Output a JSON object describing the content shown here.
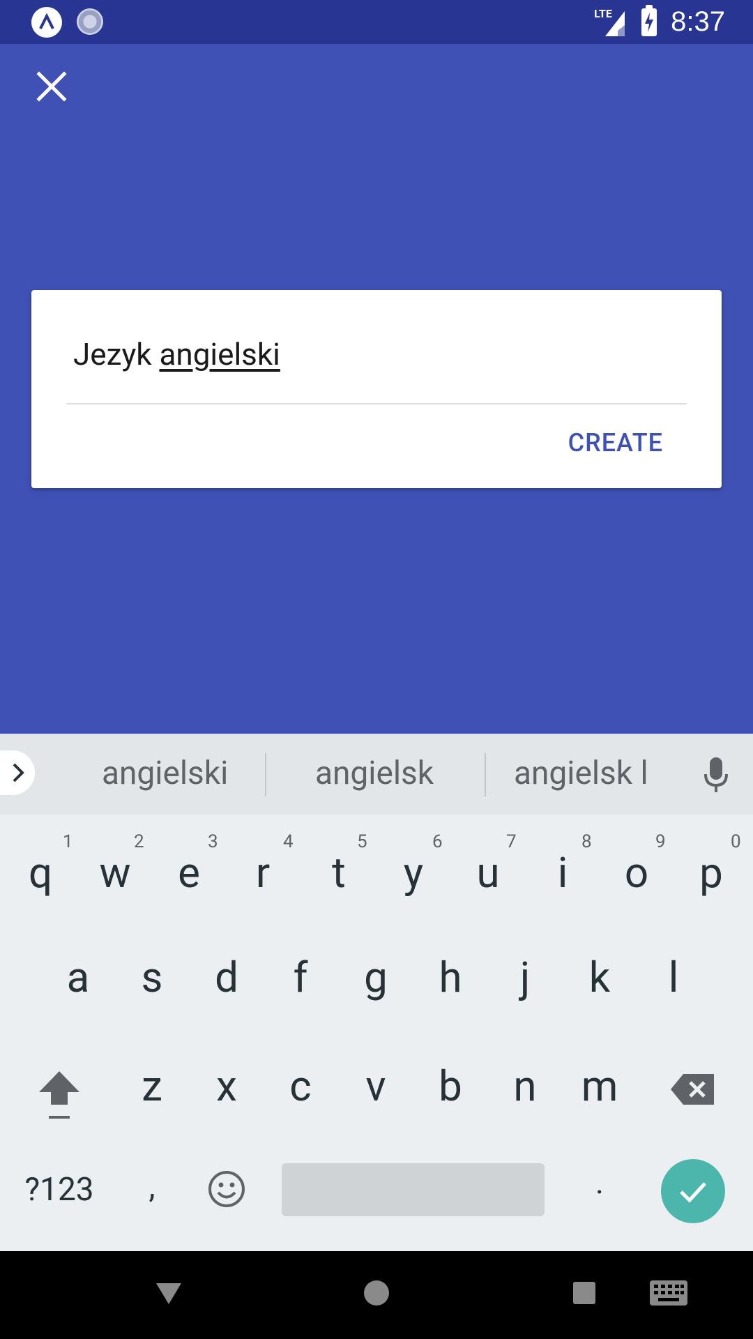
{
  "status_bar": {
    "time": "8:37",
    "network": "LTE"
  },
  "dialog": {
    "input_prefix": "Jezyk ",
    "input_underlined": "angielski",
    "create_label": "CREATE"
  },
  "keyboard": {
    "suggestions": [
      "angielski",
      "angielsk",
      "angielsk l"
    ],
    "number_row": [
      "1",
      "2",
      "3",
      "4",
      "5",
      "6",
      "7",
      "8",
      "9",
      "0"
    ],
    "row1": [
      "q",
      "w",
      "e",
      "r",
      "t",
      "y",
      "u",
      "i",
      "o",
      "p"
    ],
    "row2": [
      "a",
      "s",
      "d",
      "f",
      "g",
      "h",
      "j",
      "k",
      "l"
    ],
    "row3": [
      "z",
      "x",
      "c",
      "v",
      "b",
      "n",
      "m"
    ],
    "symbols_key": "?123",
    "comma_key": ",",
    "period_key": "."
  },
  "colors": {
    "accent": "#3f51b5",
    "status_bar": "#283593",
    "enter": "#4db6ac"
  },
  "icons": [
    "close-icon",
    "expand-icon",
    "mic-icon",
    "shift-icon",
    "backspace-icon",
    "emoji-icon",
    "check-icon",
    "back-icon",
    "home-icon",
    "recents-icon",
    "keyboard-icon"
  ]
}
